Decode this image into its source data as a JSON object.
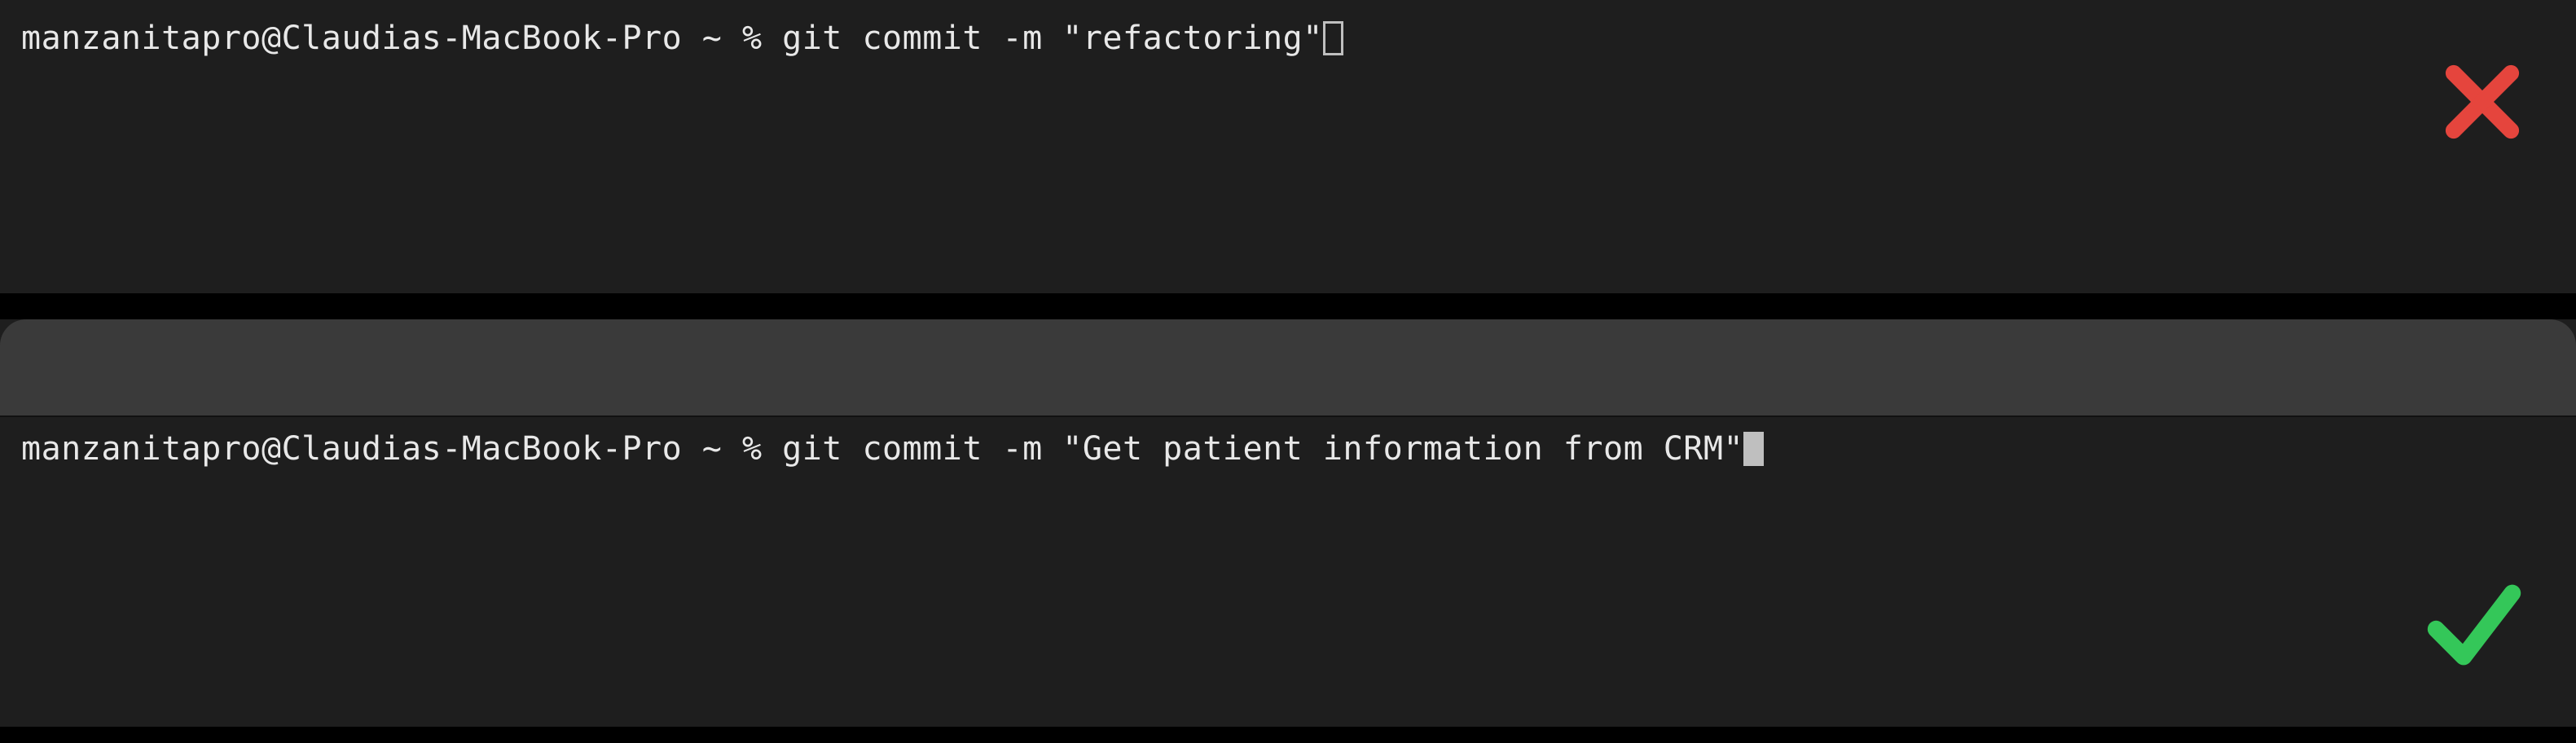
{
  "panes": {
    "top": {
      "prompt_user": "manzanitapro",
      "prompt_host": "Claudias-MacBook-Pro",
      "prompt_path": "~",
      "prompt_symbol": "%",
      "command": "git commit -m \"refactoring\"",
      "full_line": "manzanitapro@Claudias-MacBook-Pro ~ % git commit -m \"refactoring\"",
      "cursor_style": "outline",
      "status": "bad",
      "status_color": "#e5453d"
    },
    "bottom": {
      "prompt_user": "manzanitapro",
      "prompt_host": "Claudias-MacBook-Pro",
      "prompt_path": "~",
      "prompt_symbol": "%",
      "command": "git commit -m \"Get patient information from CRM\"",
      "full_line": "manzanitapro@Claudias-MacBook-Pro ~ % git commit -m \"Get patient information from CRM\"",
      "cursor_style": "solid",
      "status": "good",
      "status_color": "#34c759"
    }
  },
  "colors": {
    "pane_bg": "#1e1e1e",
    "titlebar_bg": "#3a3a3a",
    "text": "#e8e8e8",
    "cursor": "#bfbfbf"
  }
}
